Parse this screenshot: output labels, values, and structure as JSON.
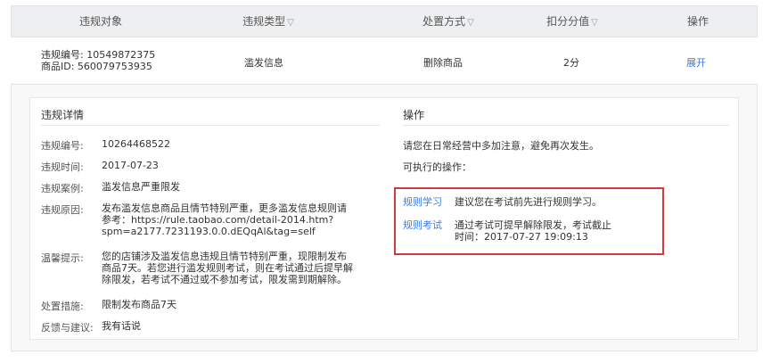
{
  "header": {
    "col_target": "违规对象",
    "col_type": "违规类型",
    "col_action": "处置方式",
    "col_points": "扣分分值",
    "col_ops": "操作",
    "filter_glyph": "▽"
  },
  "row": {
    "violation_no": "违规编号: 10549872375",
    "product_id": "商品ID: 560079753935",
    "type": "滥发信息",
    "action": "删除商品",
    "points": "2分",
    "expand_link": "展开"
  },
  "detail": {
    "title": "违规详情",
    "fields": [
      {
        "label": "违规编号:",
        "value": "10264468522"
      },
      {
        "label": "违规时间:",
        "value": "2017-07-23"
      },
      {
        "label": "违规案例:",
        "value": "滥发信息严重限发"
      },
      {
        "label": "违规原因:",
        "value_lines": [
          "发布滥发信息商品且情节特别严重，更多滥发信息规则请",
          "参考：https://rule.taobao.com/detail-2014.htm?",
          "spm=a2177.7231193.0.0.dEQqAl&tag=self"
        ]
      },
      {
        "label": "温馨提示:",
        "value_lines": [
          "您的店铺涉及滥发信息违规且情节特别严重，现限制发布",
          "商品7天。若您进行滥发规则考试，则在考试通过后提早解",
          "除限发，若考试不通过或不参加考试，限发需到期解除。"
        ]
      },
      {
        "label": "处置措施:",
        "value": "限制发布商品7天"
      },
      {
        "label": "反馈与建议:",
        "value": "我有话说"
      }
    ]
  },
  "operations": {
    "title": "操作",
    "notice": "请您在日常经营中多加注意，避免再次发生。",
    "available": "可执行的操作：",
    "actions": [
      {
        "link": "规则学习",
        "desc_lines": [
          "建议您在考试前先进行规则学习。"
        ]
      },
      {
        "link": "规则考试",
        "desc_lines": [
          "通过考试可提早解除限发，考试截止",
          "时间：2017-07-27  19:09:13"
        ]
      }
    ]
  },
  "colors": {
    "link": "#3c7be0",
    "highlight_border": "#d23a3a",
    "header_bg": "#eeeff1"
  }
}
